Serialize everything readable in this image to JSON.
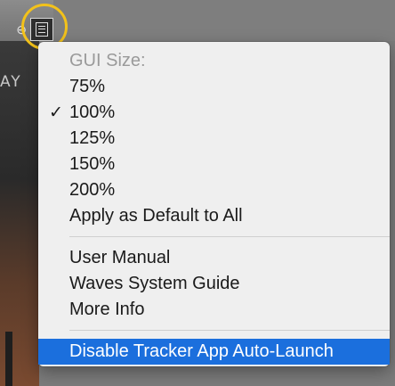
{
  "background": {
    "left_button_glyph": "⊖",
    "plugin_text_fragment": "AY"
  },
  "menu_button": {
    "icon": "hamburger-menu-icon"
  },
  "menu": {
    "header": "GUI Size:",
    "checkmark": "✓",
    "items": [
      {
        "label": "75%"
      },
      {
        "label": "100%",
        "checked": true
      },
      {
        "label": "125%"
      },
      {
        "label": "150%"
      },
      {
        "label": "200%"
      },
      {
        "label": "Apply as Default to All"
      },
      {
        "label": "User Manual"
      },
      {
        "label": "Waves System Guide"
      },
      {
        "label": "More Info"
      },
      {
        "label": "Disable Tracker App Auto-Launch",
        "highlighted": true
      }
    ]
  },
  "colors": {
    "highlight_ring": "#f3c21a",
    "menu_selection": "#1b6fdd"
  }
}
